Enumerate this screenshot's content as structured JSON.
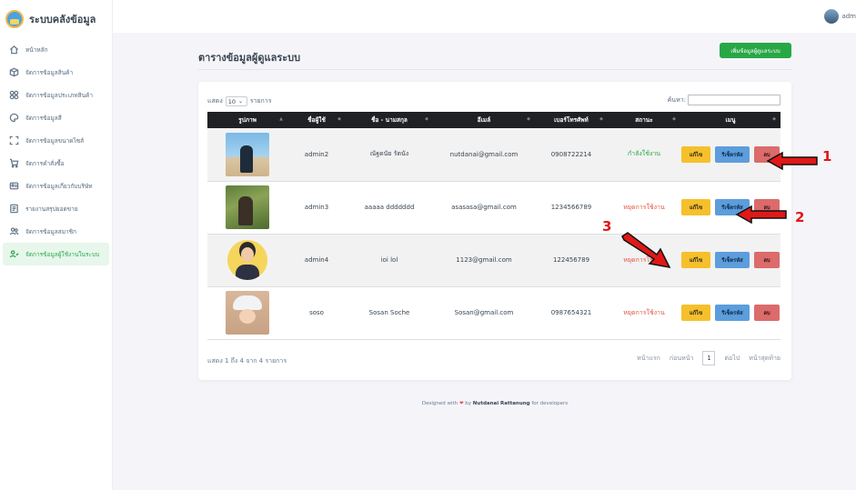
{
  "brand": {
    "title": "ระบบคลังข้อมูล"
  },
  "sidebar": {
    "items": [
      {
        "label": "หน้าหลัก",
        "icon": "home-icon"
      },
      {
        "label": "จัดการข้อมูลสินค้า",
        "icon": "box-icon"
      },
      {
        "label": "จัดการข้อมูลประเภทสินค้า",
        "icon": "category-icon"
      },
      {
        "label": "จัดการข้อมูลสี",
        "icon": "palette-icon"
      },
      {
        "label": "จัดการข้อมูลขนาดไซส์",
        "icon": "size-icon"
      },
      {
        "label": "จัดการคำสั่งซื้อ",
        "icon": "cart-icon"
      },
      {
        "label": "จัดการข้อมูลเกี่ยวกับบริษัท",
        "icon": "company-icon"
      },
      {
        "label": "รายงานสรุปยอดขาย",
        "icon": "report-icon"
      },
      {
        "label": "จัดการข้อมูลสมาชิก",
        "icon": "members-icon"
      },
      {
        "label": "จัดการข้อมูลผู้ใช้งานในระบบ",
        "icon": "admin-users-icon"
      }
    ],
    "active_index": 9
  },
  "topbar": {
    "username": "adm"
  },
  "page": {
    "title": "ตารางข้อมูลผู้ดูแลระบบ",
    "add_button": "เพิ่มข้อมูลผู้ดูแลระบบ"
  },
  "table_controls": {
    "show_prefix": "แสดง",
    "show_value": "10",
    "show_suffix": "รายการ",
    "search_label": "ค้นหา:"
  },
  "table": {
    "headers": [
      "รูปภาพ",
      "ชื่อผู้ใช้",
      "ชื่อ - นามสกุล",
      "อีเมล์",
      "เบอร์โทรศัพท์",
      "สถานะ",
      "เมนู"
    ],
    "rows": [
      {
        "username": "admin2",
        "fullname": "ณัฐดนัย รัตนัง",
        "email": "nutdanai@gmail.com",
        "phone": "0908722214",
        "status": "กำลังใช้งาน",
        "status_type": "active"
      },
      {
        "username": "admin3",
        "fullname": "aaaaa ddddddd",
        "email": "asasasa@gmail.com",
        "phone": "1234566789",
        "status": "หยุดการใช้งาน",
        "status_type": "stopped"
      },
      {
        "username": "admin4",
        "fullname": "ioi lol",
        "email": "1123@gmail.com",
        "phone": "122456789",
        "status": "หยุดการใช้งาน",
        "status_type": "stopped"
      },
      {
        "username": "soso",
        "fullname": "Sosan Soche",
        "email": "Sosan@gmail.com",
        "phone": "0987654321",
        "status": "หยุดการใช้งาน",
        "status_type": "stopped"
      }
    ],
    "actions": {
      "edit": "แก้ไข",
      "reset": "รีเซ็ตรหัส",
      "delete": "ลบ"
    }
  },
  "pagination": {
    "info": "แสดง 1 ถึง 4 จาก 4 รายการ",
    "first": "หน้าแรก",
    "previous": "ก่อนหน้า",
    "current": "1",
    "next": "ต่อไป",
    "last": "หน้าสุดท้าย"
  },
  "footer": {
    "prefix": "Designed with",
    "heart": "❤",
    "by": "by",
    "author": "Nutdanai Rattanung",
    "suffix": "for developers"
  },
  "annotations": {
    "a1": "1",
    "a2": "2",
    "a3": "3"
  },
  "colors": {
    "accent_green": "#28a745",
    "edit_yellow": "#f5c02b",
    "reset_blue": "#5c9ddc",
    "delete_red": "#dc6b6b",
    "annotation_red": "#e01818"
  }
}
